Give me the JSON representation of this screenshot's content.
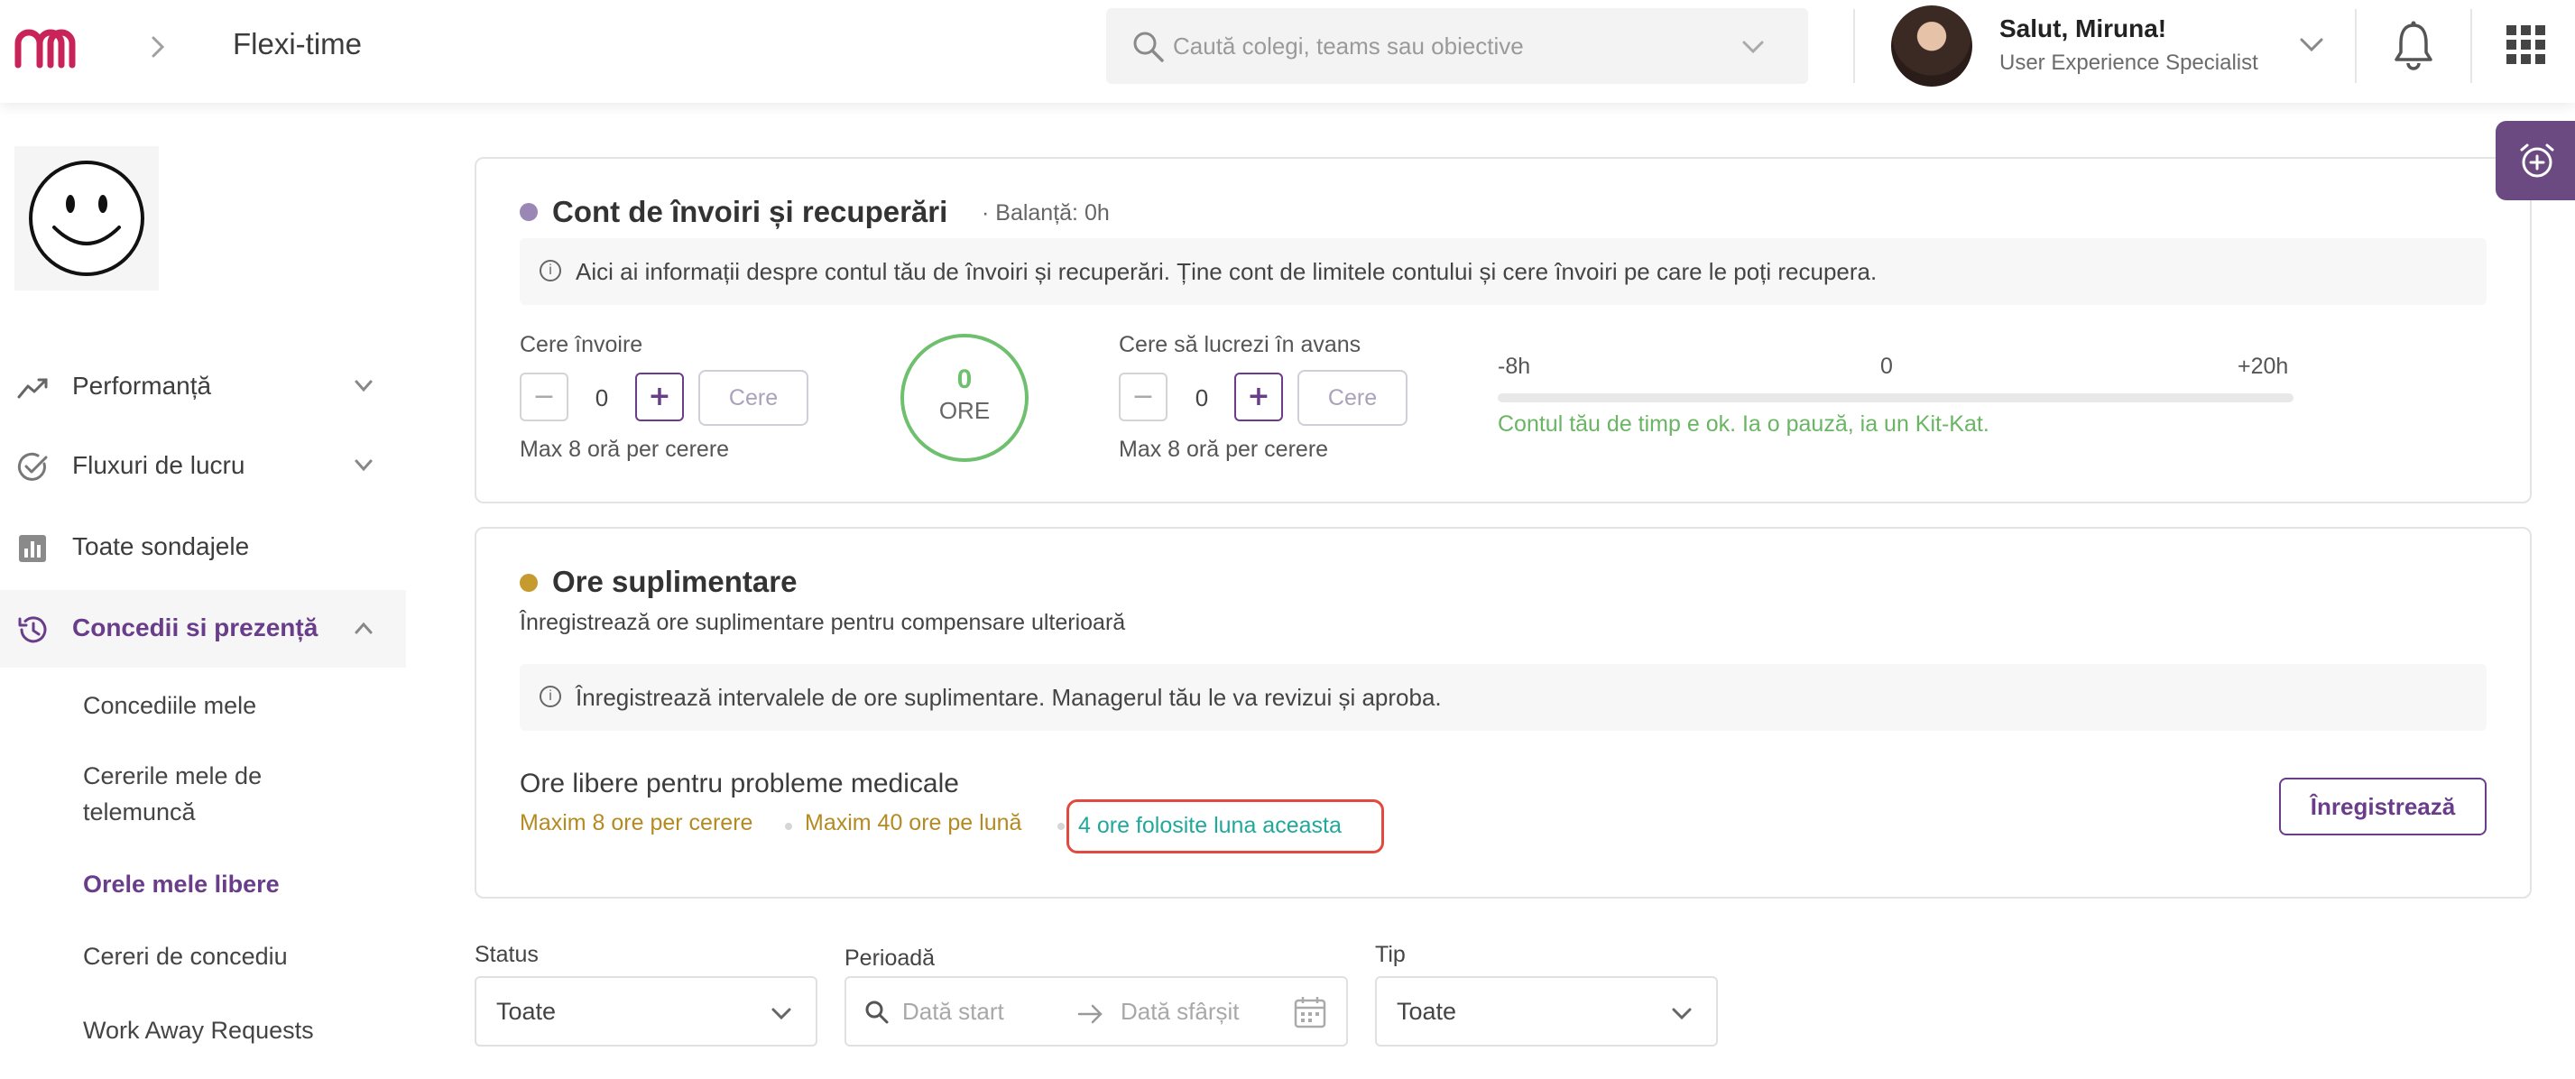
{
  "header": {
    "title": "Flexi-time",
    "search_placeholder": "Caută colegi, teams sau obiective",
    "greeting": "Salut, Miruna!",
    "role": "User Experience Specialist"
  },
  "sidebar": {
    "items": [
      {
        "label": "Performanță",
        "icon": "trend-icon"
      },
      {
        "label": "Fluxuri de lucru",
        "icon": "check-circle-icon"
      },
      {
        "label": "Toate sondajele",
        "icon": "bar-chart-icon"
      },
      {
        "label": "Concedii si prezență",
        "icon": "history-icon"
      }
    ],
    "sub_items": [
      {
        "label": "Concediile mele"
      },
      {
        "label": "Cererile mele de telemuncă"
      },
      {
        "label": "Orele mele libere"
      },
      {
        "label": "Cereri de concediu"
      },
      {
        "label": "Work Away Requests"
      }
    ]
  },
  "account_card": {
    "title": "Cont de învoiri și recuperări",
    "balance": "· Balanță: 0h",
    "info": "Aici ai informații despre contul tău de învoiri și recuperări. Ține cont de limitele contului și cere învoiri pe care le poți recupera.",
    "leave": {
      "label": "Cere învoire",
      "value": "0",
      "button": "Cere",
      "note": "Max 8 oră per cerere"
    },
    "circle": {
      "value": "0",
      "unit": "ORE"
    },
    "advance": {
      "label": "Cere să lucrezi în avans",
      "value": "0",
      "button": "Cere",
      "note": "Max 8 oră per cerere"
    },
    "scale": {
      "min": "-8h",
      "mid": "0",
      "max": "+20h"
    },
    "status_message": "Contul tău de timp e ok. Ia o pauză, ia un Kit-Kat."
  },
  "overtime_card": {
    "title": "Ore suplimentare",
    "subtitle": "Înregistrează ore suplimentare pentru compensare ulterioară",
    "info": "Înregistrează intervalele de ore suplimentare. Managerul tău le va revizui și aproba.",
    "medical_title": "Ore libere pentru probleme medicale",
    "max_per_request": "Maxim 8 ore per cerere",
    "max_per_month": "Maxim 40 ore pe lună",
    "used_this_month": "4 ore folosite luna aceasta",
    "register_button": "Înregistrează"
  },
  "filters": {
    "status_label": "Status",
    "status_value": "Toate",
    "period_label": "Perioadă",
    "start_placeholder": "Dată start",
    "end_placeholder": "Dată sfârșit",
    "type_label": "Tip",
    "type_value": "Toate"
  },
  "colors": {
    "accent": "#6a3d8a",
    "green": "#6ec06e",
    "gold": "#b48a22",
    "teal": "#21a89a",
    "highlight_border": "#e14a3e"
  }
}
